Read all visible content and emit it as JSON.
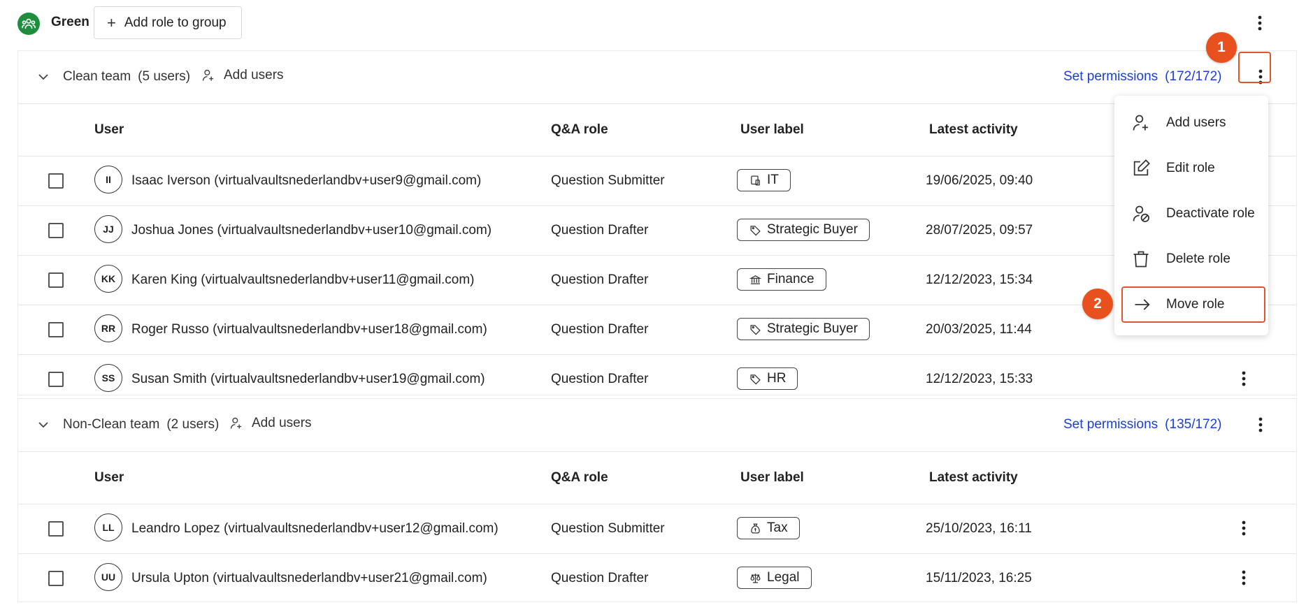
{
  "group": {
    "name": "Green",
    "add_role_label": "Add role to group"
  },
  "roles": [
    {
      "name": "Clean team",
      "count": "(5 users)",
      "add_users": "Add users",
      "set_permissions": "Set permissions",
      "permissions_count": "(172/172)",
      "columns": {
        "user": "User",
        "qa_role": "Q&A role",
        "label": "User label",
        "activity": "Latest activity"
      },
      "rows": [
        {
          "initials": "II",
          "name": "Isaac Iverson (virtualvaultsnederlandbv+user9@gmail.com)",
          "qa_role": "Question Submitter",
          "label": "IT",
          "label_icon": "device-icon",
          "activity": "19/06/2025, 09:40"
        },
        {
          "initials": "JJ",
          "name": "Joshua Jones (virtualvaultsnederlandbv+user10@gmail.com)",
          "qa_role": "Question Drafter",
          "label": "Strategic Buyer",
          "label_icon": "tag-icon",
          "activity": "28/07/2025, 09:57"
        },
        {
          "initials": "KK",
          "name": "Karen King (virtualvaultsnederlandbv+user11@gmail.com)",
          "qa_role": "Question Drafter",
          "label": "Finance",
          "label_icon": "bank-icon",
          "activity": "12/12/2023, 15:34"
        },
        {
          "initials": "RR",
          "name": "Roger Russo (virtualvaultsnederlandbv+user18@gmail.com)",
          "qa_role": "Question Drafter",
          "label": "Strategic Buyer",
          "label_icon": "tag-icon",
          "activity": "20/03/2025, 11:44"
        },
        {
          "initials": "SS",
          "name": "Susan Smith (virtualvaultsnederlandbv+user19@gmail.com)",
          "qa_role": "Question Drafter",
          "label": "HR",
          "label_icon": "tag-icon",
          "activity": "12/12/2023, 15:33"
        }
      ]
    },
    {
      "name": "Non-Clean team",
      "count": "(2 users)",
      "add_users": "Add users",
      "set_permissions": "Set permissions",
      "permissions_count": "(135/172)",
      "columns": {
        "user": "User",
        "qa_role": "Q&A role",
        "label": "User label",
        "activity": "Latest activity"
      },
      "rows": [
        {
          "initials": "LL",
          "name": "Leandro Lopez (virtualvaultsnederlandbv+user12@gmail.com)",
          "qa_role": "Question Submitter",
          "label": "Tax",
          "label_icon": "money-bag-icon",
          "activity": "25/10/2023, 16:11"
        },
        {
          "initials": "UU",
          "name": "Ursula Upton (virtualvaultsnederlandbv+user21@gmail.com)",
          "qa_role": "Question Drafter",
          "label": "Legal",
          "label_icon": "scale-icon",
          "activity": "15/11/2023, 16:25"
        }
      ]
    }
  ],
  "menu": {
    "items": [
      {
        "label": "Add users",
        "icon": "add-user-icon"
      },
      {
        "label": "Edit role",
        "icon": "edit-icon"
      },
      {
        "label": "Deactivate role",
        "icon": "deactivate-user-icon"
      },
      {
        "label": "Delete role",
        "icon": "trash-icon"
      },
      {
        "label": "Move role",
        "icon": "arrow-right-icon"
      }
    ]
  },
  "steps": [
    "1",
    "2"
  ],
  "colors": {
    "accent": "#e8501e",
    "link": "#1a3fd8",
    "group": "#1e8e3e"
  }
}
